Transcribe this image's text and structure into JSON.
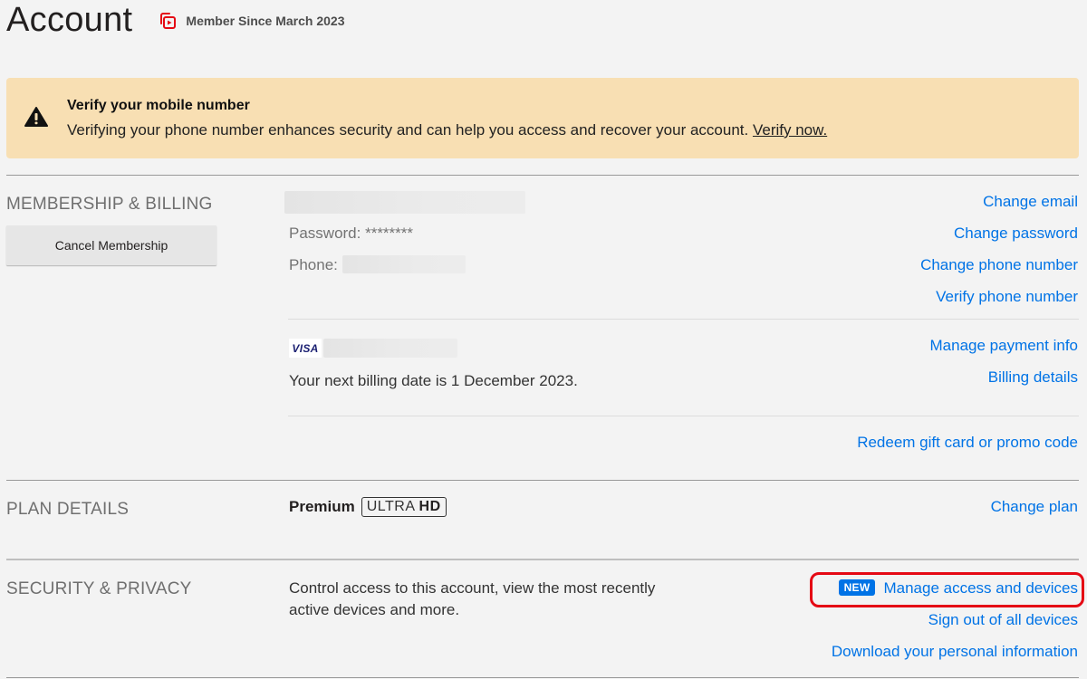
{
  "header": {
    "title": "Account",
    "member_since": "Member Since March 2023",
    "member_icon": "member-badge-icon"
  },
  "banner": {
    "icon": "warning-icon",
    "title": "Verify your mobile number",
    "body": "Verifying your phone number enhances security and can help you access and recover your account.",
    "link": "Verify now."
  },
  "membership": {
    "label": "MEMBERSHIP & BILLING",
    "cancel_button": "Cancel Membership",
    "password_label": "Password: ********",
    "phone_label": "Phone:",
    "card_brand": "VISA",
    "billing_date": "Your next billing date is 1 December 2023.",
    "links": {
      "change_email": "Change email",
      "change_password": "Change password",
      "change_phone": "Change phone number",
      "verify_phone": "Verify phone number",
      "manage_payment": "Manage payment info",
      "billing_details": "Billing details",
      "redeem": "Redeem gift card or promo code"
    }
  },
  "plan": {
    "label": "PLAN DETAILS",
    "name": "Premium",
    "badge_light": "ULTRA",
    "badge_bold": "HD",
    "change_plan": "Change plan"
  },
  "security": {
    "label": "SECURITY & PRIVACY",
    "description": "Control access to this account, view the most recently active devices and more.",
    "new_badge": "NEW",
    "manage_access": "Manage access and devices",
    "sign_out_all": "Sign out of all devices",
    "download_info": "Download your personal information"
  },
  "colors": {
    "link": "#0073e6",
    "banner_bg": "#f8dfb3",
    "highlight": "#e50914",
    "brand_red": "#e50914"
  }
}
